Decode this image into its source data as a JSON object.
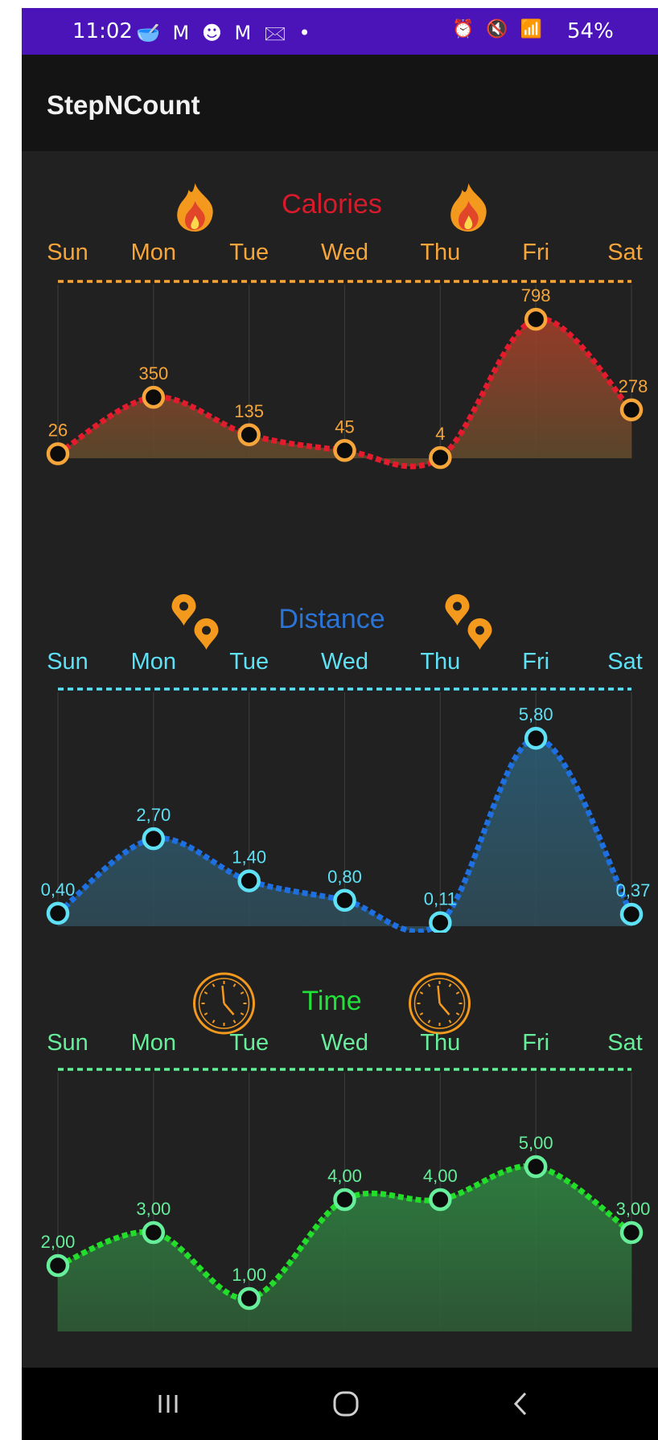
{
  "status_bar": {
    "time": "11:02",
    "left_icons": "🥣 M ☻ M 🖂 •",
    "right_icons": "⏰ 🔇 📶",
    "battery": "54%"
  },
  "app_bar": {
    "title": "StepNCount"
  },
  "chart_data": [
    {
      "type": "area",
      "title": "Calories",
      "categories": [
        "Sun",
        "Mon",
        "Tue",
        "Wed",
        "Thu",
        "Fri",
        "Sat"
      ],
      "values": [
        26,
        350,
        135,
        45,
        4,
        798,
        278
      ],
      "labels": [
        "26",
        "350",
        "135",
        "45",
        "4",
        "798",
        "278"
      ],
      "ylim": [
        0,
        900
      ],
      "colors": {
        "title": "#d81a2a",
        "line": "#e31b2d",
        "marker": "#f5a53a",
        "label": "#f5a53a",
        "tick": "#f5a53a",
        "fill": "#a8402a",
        "fill_bottom": "#5a4a2c"
      },
      "icon": "fire-icon",
      "grid": true
    },
    {
      "type": "area",
      "title": "Distance",
      "categories": [
        "Sun",
        "Mon",
        "Tue",
        "Wed",
        "Thu",
        "Fri",
        "Sat"
      ],
      "values": [
        0.4,
        2.7,
        1.4,
        0.8,
        0.11,
        5.8,
        0.37
      ],
      "labels": [
        "0,40",
        "2,70",
        "1,40",
        "0,80",
        "0,11",
        "5,80",
        "0,37"
      ],
      "ylim": [
        0,
        6.5
      ],
      "colors": {
        "title": "#2b74d6",
        "line": "#1e6fe0",
        "marker": "#5ee0f5",
        "label": "#5ee0f5",
        "tick": "#5ee0f5",
        "fill": "#2c5f78",
        "fill_bottom": "#2f4a55"
      },
      "icon": "location-pin-icon",
      "grid": true
    },
    {
      "type": "area",
      "title": "Time",
      "categories": [
        "Sun",
        "Mon",
        "Tue",
        "Wed",
        "Thu",
        "Fri",
        "Sat"
      ],
      "values": [
        2.0,
        3.0,
        1.0,
        4.0,
        4.0,
        5.0,
        3.0
      ],
      "labels": [
        "2,00",
        "3,00",
        "1,00",
        "4,00",
        "4,00",
        "5,00",
        "3,00"
      ],
      "ylim": [
        0,
        6
      ],
      "colors": {
        "title": "#22e03a",
        "line": "#22dd2a",
        "marker": "#66ee9a",
        "label": "#66ee9a",
        "tick": "#66ee9a",
        "fill": "#2f8a44",
        "fill_bottom": "#2e5a36"
      },
      "icon": "clock-icon",
      "grid": true
    }
  ]
}
